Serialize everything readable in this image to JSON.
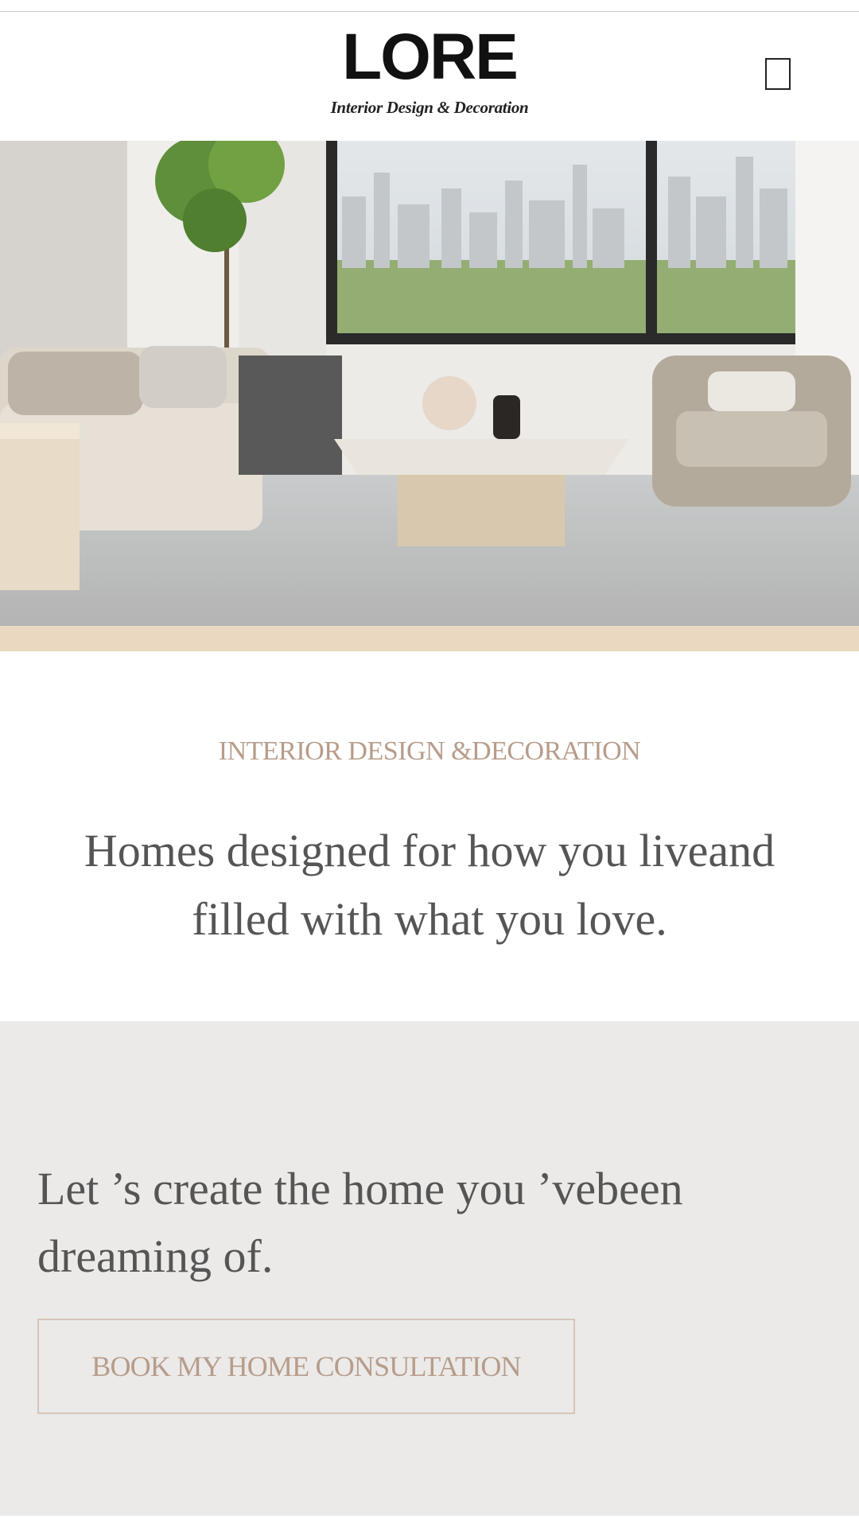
{
  "header": {
    "logo_text": "LORE",
    "logo_tagline": "Interior Design & Decoration",
    "menu_icon": "hamburger-menu-icon"
  },
  "hero": {
    "image": "living-room-with-city-view"
  },
  "intro": {
    "eyebrow": "INTERIOR DESIGN &DECORATION",
    "headline": "Homes designed for how you liveand filled with what you love."
  },
  "cta": {
    "text": "Let ’s create the home you ’vebeen dreaming of.",
    "button_label": "BOOK MY HOME CONSULTATION"
  },
  "colors": {
    "accent": "#b79c8a",
    "button_border": "#d6c5b8",
    "cta_background": "#ebeae9",
    "body_text": "#555555"
  }
}
